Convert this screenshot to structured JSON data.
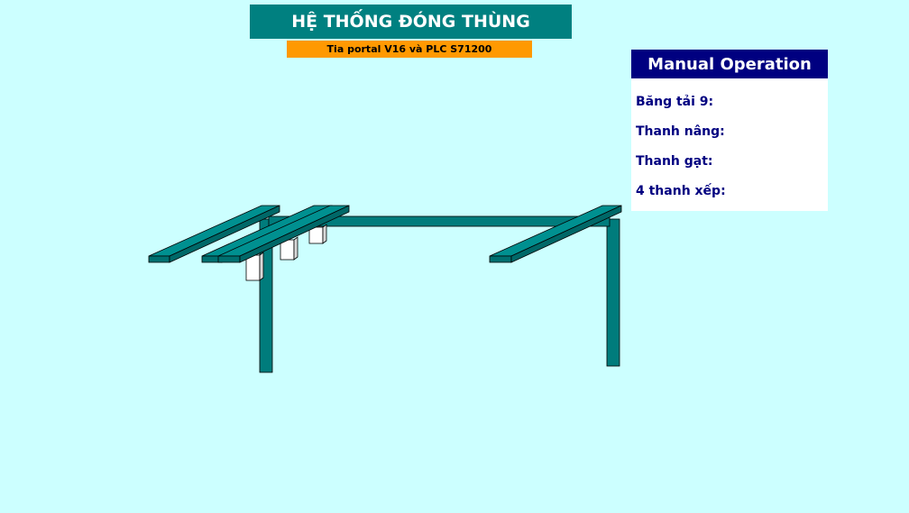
{
  "header": {
    "title": "HỆ THỐNG ĐÓNG THÙNG",
    "subtitle": "Tia portal V16 và PLC S71200"
  },
  "manual_panel": {
    "title": "Manual Operation",
    "items": [
      {
        "label": "Băng tải 9:"
      },
      {
        "label": "Thanh nâng:"
      },
      {
        "label": "Thanh gạt:"
      },
      {
        "label": "4 thanh xếp:"
      }
    ]
  },
  "colors": {
    "background": "#ccffff",
    "title_bg": "#008080",
    "subtitle_bg": "#ff9900",
    "panel_header_bg": "#000080",
    "panel_text": "#000080",
    "frame": "#007c7c"
  }
}
